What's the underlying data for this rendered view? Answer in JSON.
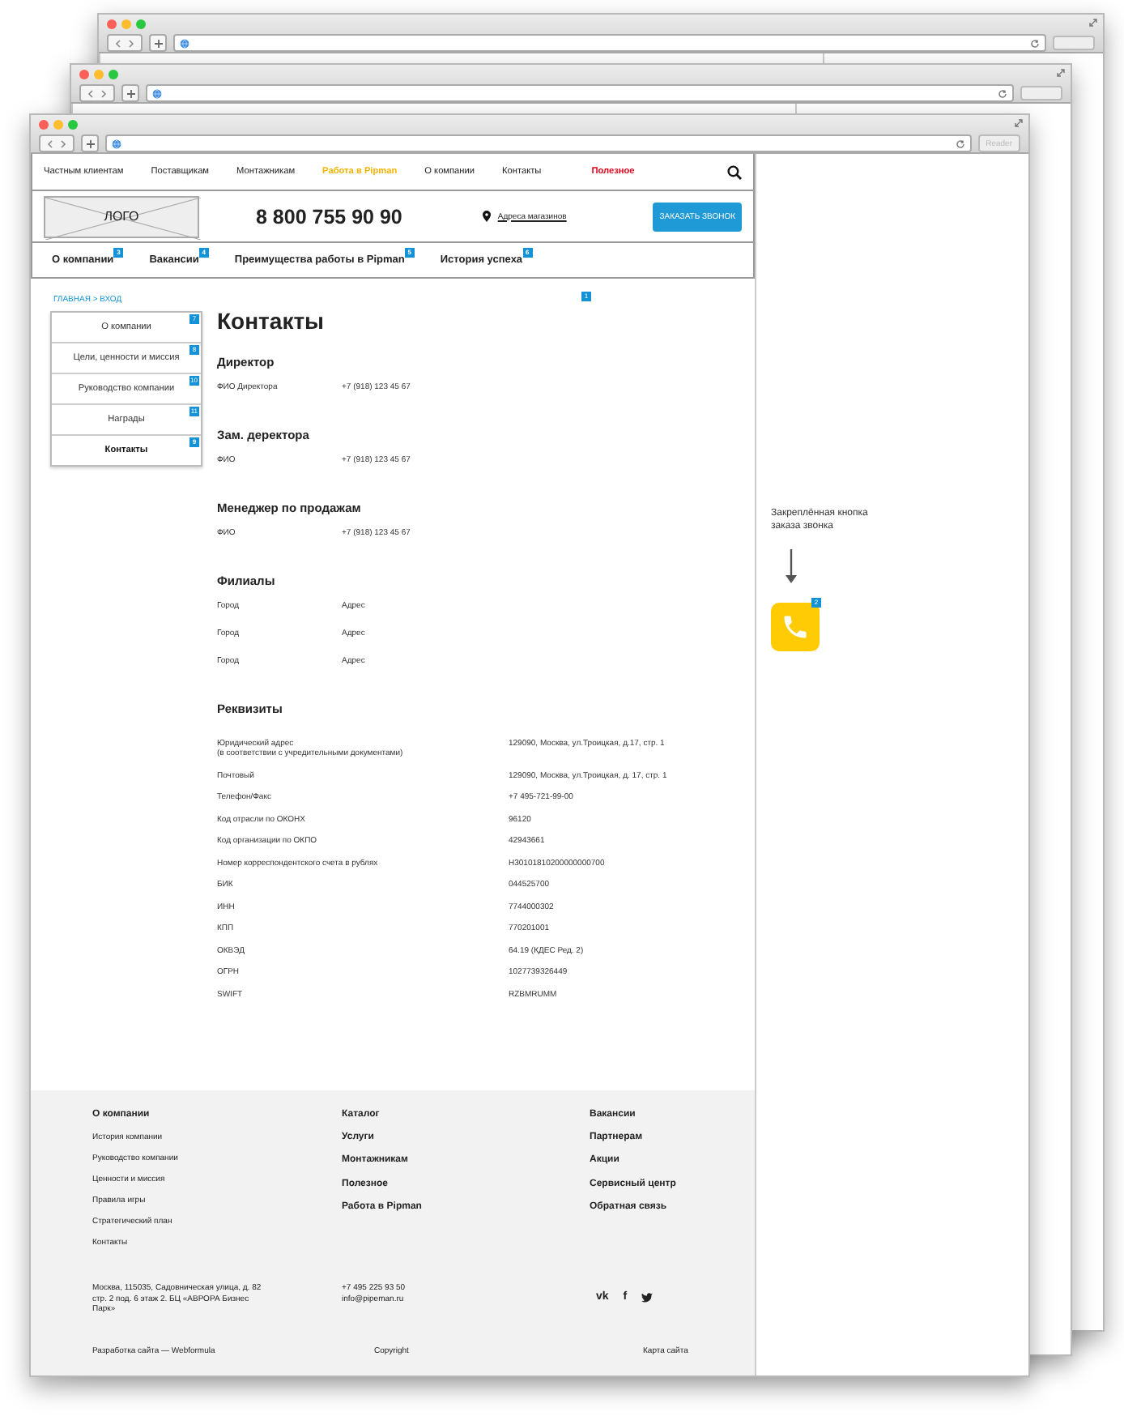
{
  "browser": {
    "reader_label": "Reader"
  },
  "nav": [
    {
      "label": "Частным клиентам",
      "kind": "plain"
    },
    {
      "label": "Поставщикам",
      "kind": "plain"
    },
    {
      "label": "Монтажникам",
      "kind": "plain"
    },
    {
      "label": "Работа в Pipman",
      "kind": "featured"
    },
    {
      "label": "О компании",
      "kind": "plain"
    },
    {
      "label": "Контакты",
      "kind": "plain"
    },
    {
      "label": "Полезное",
      "kind": "alert"
    }
  ],
  "logo": "ЛОГО",
  "phone": "8 800 755 90 90",
  "stores_link": "Адреса магазинов",
  "callback_button": "ЗАКАЗАТЬ ЗВОНОК",
  "tabs": [
    {
      "label": "О компании",
      "badge": "3"
    },
    {
      "label": "Вакансии",
      "badge": "4"
    },
    {
      "label": "Преимущества работы в Pipman",
      "badge": "5"
    },
    {
      "label": "История успеха",
      "badge": "6"
    }
  ],
  "breadcrumb": "ГЛАВНАЯ > ВХОД",
  "sidebar": [
    {
      "label": "О компании",
      "badge": "7",
      "selected": false
    },
    {
      "label": "Цели, ценности и миссия",
      "badge": "8",
      "selected": false
    },
    {
      "label": "Руководство компании",
      "badge": "10",
      "selected": false
    },
    {
      "label": "Награды",
      "badge": "11",
      "selected": false
    },
    {
      "label": "Контакты",
      "badge": "9",
      "selected": true
    }
  ],
  "page_badge": "1",
  "title": "Контакты",
  "contacts": [
    {
      "heading": "Директор",
      "rows": [
        {
          "name": "ФИО Директора",
          "phone": "+7 (918) 123 45 67"
        }
      ]
    },
    {
      "heading": "Зам. деректора",
      "rows": [
        {
          "name": "ФИО",
          "phone": "+7 (918) 123 45 67"
        }
      ]
    },
    {
      "heading": "Менеджер по продажам",
      "rows": [
        {
          "name": "ФИО",
          "phone": "+7 (918) 123 45 67"
        }
      ]
    }
  ],
  "branches": {
    "heading": "Филиалы",
    "rows": [
      {
        "city": "Город",
        "address": "Адрес"
      },
      {
        "city": "Город",
        "address": "Адрес"
      },
      {
        "city": "Город",
        "address": "Адрес"
      }
    ]
  },
  "requisites": {
    "heading": "Реквизиты",
    "rows": [
      {
        "label": "Юридический адрес",
        "note": "(в соответствии с учредительными документами)",
        "value": "129090, Москва, ул.Троицкая, д.17, стр. 1"
      },
      {
        "label": "Почтовый",
        "value": "129090, Москва, ул.Троицкая, д. 17, стр. 1"
      },
      {
        "label": "Телефон/Факс",
        "value": "+7 495-721-99-00"
      },
      {
        "label": "Код отрасли по ОКОНХ",
        "value": "96120"
      },
      {
        "label": "Код организации по ОКПО",
        "value": "42943661"
      },
      {
        "label": "Номер корреспондентского счета в рублях",
        "value": "Н30101810200000000700"
      },
      {
        "label": "БИК",
        "value": "044525700"
      },
      {
        "label": "ИНН",
        "value": "7744000302"
      },
      {
        "label": "КПП",
        "value": "770201001"
      },
      {
        "label": "ОКВЭД",
        "value": "64.19 (КДЕС Ред. 2)"
      },
      {
        "label": "ОГРН",
        "value": "1027739326449"
      },
      {
        "label": "SWIFT",
        "value": "RZBMRUMM"
      }
    ]
  },
  "pinned_callback": {
    "caption": "Закреплённая кнопка заказа звонка",
    "badge": "2"
  },
  "footer": {
    "about_heading": "О компании",
    "about_links": [
      "История компании",
      "Руководство компании",
      "Ценности и миссия",
      "Правила игры",
      "Стратегический план",
      "Контакты"
    ],
    "middle_links": [
      "Каталог",
      "Услуги",
      "Монтажникам",
      "Полезное",
      "Работа в Pipman"
    ],
    "right_links": [
      "Вакансии",
      "Партнерам",
      "Акции",
      "Сервисный центр",
      "Обратная связь"
    ],
    "address": "Москва, 115035, Садовническая улица, д. 82 стр. 2 под. 6 этаж 2. БЦ «АВРОРА Бизнес Парк»",
    "phone": "+7 495 225 93 50",
    "email": "info@pipeman.ru",
    "social": [
      "vk",
      "f"
    ],
    "developer": "Разработка сайта — Webformula",
    "copyright": "Copyright",
    "sitemap": "Карта сайта"
  }
}
